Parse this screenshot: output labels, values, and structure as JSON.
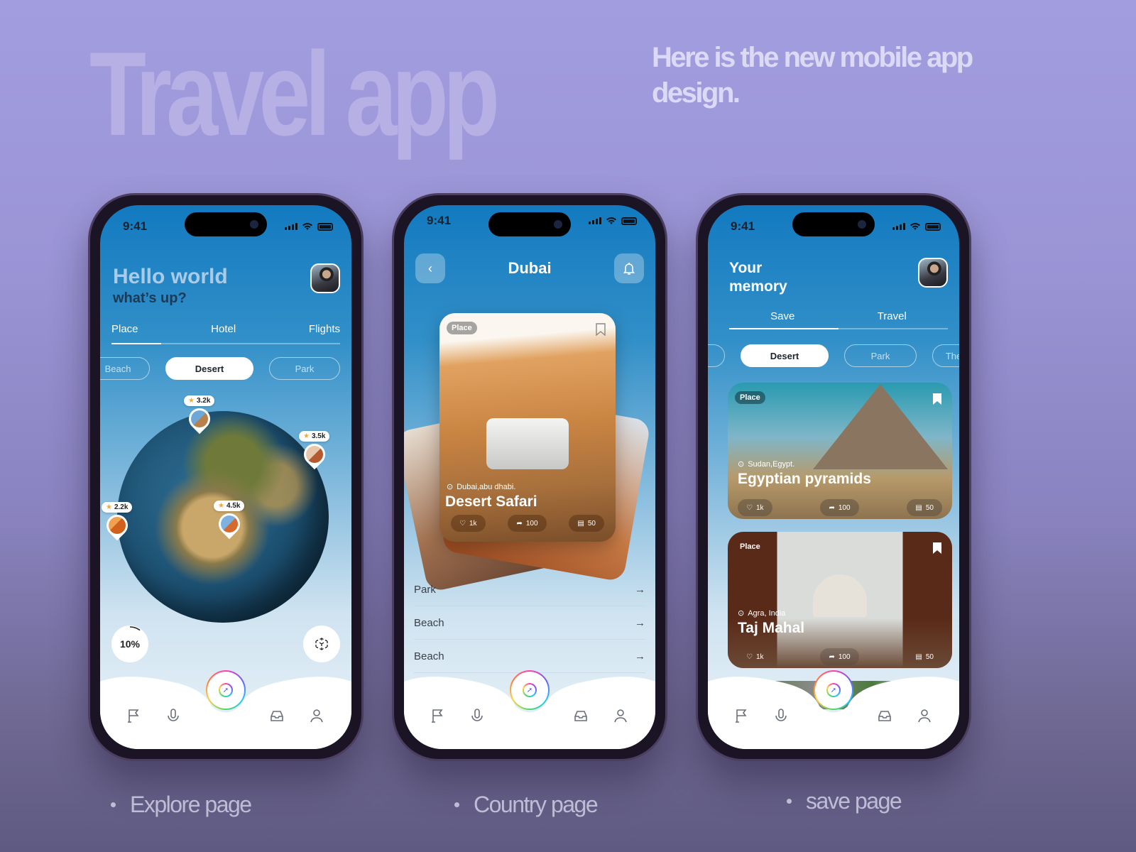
{
  "hero": {
    "title": "Travel  app",
    "subtitle": "Here is the new mobile app design."
  },
  "captions": [
    "Explore page",
    "Country page",
    "save page"
  ],
  "status": {
    "time": "9:41"
  },
  "explore": {
    "greeting": "Hello world",
    "subgreeting": "what’s up?",
    "tabs": [
      {
        "label": "Place",
        "active": true
      },
      {
        "label": "Hotel"
      },
      {
        "label": "Flights"
      }
    ],
    "chips": [
      {
        "label": "Beach"
      },
      {
        "label": "Desert",
        "active": true
      },
      {
        "label": "Park"
      }
    ],
    "pins": [
      {
        "rating": "3.2k"
      },
      {
        "rating": "3.5k"
      },
      {
        "rating": "2.2k"
      },
      {
        "rating": "4.5k"
      }
    ],
    "progress_label": "10%",
    "progress_value": 10
  },
  "country": {
    "title": "Dubai",
    "card": {
      "tag": "Place",
      "location": "Dubai,abu dhabi.",
      "title": "Desert Safari",
      "likes": "1k",
      "shares": "100",
      "comments": "50"
    },
    "list": [
      {
        "label": "Park"
      },
      {
        "label": "Beach"
      },
      {
        "label": "Beach"
      }
    ]
  },
  "save": {
    "title_line1": "Your",
    "title_line2": "memory",
    "tabs": [
      {
        "label": "Save",
        "active": true
      },
      {
        "label": "Travel"
      }
    ],
    "chips": [
      {
        "label": ""
      },
      {
        "label": "Desert",
        "active": true
      },
      {
        "label": "Park"
      },
      {
        "label": "The"
      }
    ],
    "cards": [
      {
        "tag": "Place",
        "location": "Sudan,Egypt.",
        "title": "Egyptian pyramids",
        "likes": "1k",
        "shares": "100",
        "comments": "50"
      },
      {
        "tag": "Place",
        "location": "Agra, India",
        "title": "Taj Mahal",
        "likes": "1k",
        "shares": "100",
        "comments": "50"
      }
    ]
  },
  "nav": {
    "icons": [
      "flag-icon",
      "microphone-icon",
      "compass-icon",
      "inbox-icon",
      "profile-icon"
    ]
  },
  "colors": {
    "accent_blue": "#137ac0",
    "background_purple": "#a29ddf"
  }
}
